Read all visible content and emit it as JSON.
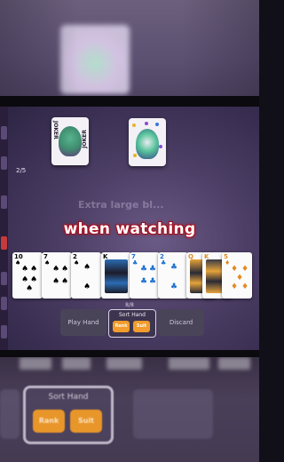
{
  "hud": {
    "hand_counter": "2/5",
    "cards_count": "8/8"
  },
  "caption": {
    "ghost_text": "Extra large bl...",
    "main_text": "when watching"
  },
  "jokers": [
    {
      "name": "joker",
      "label_left": "JOKER",
      "label_right": "JOKER"
    },
    {
      "name": "joker"
    }
  ],
  "hand": [
    {
      "rank": "10",
      "suit": "♠",
      "color": "#1b1b1b"
    },
    {
      "rank": "7",
      "suit": "♠",
      "color": "#1b1b1b"
    },
    {
      "rank": "2",
      "suit": "♠",
      "color": "#1b1b1b"
    },
    {
      "rank": "K",
      "suit": "♠",
      "color": "#1b1b1b"
    },
    {
      "rank": "7",
      "suit": "♣",
      "color": "#1c6fd1"
    },
    {
      "rank": "2",
      "suit": "♣",
      "color": "#1c6fd1"
    },
    {
      "rank": "Q",
      "suit": "♦",
      "color": "#e58a1f"
    },
    {
      "rank": "K",
      "suit": "♦",
      "color": "#e58a1f"
    },
    {
      "rank": "5",
      "suit": "♦",
      "color": "#e58a1f"
    }
  ],
  "buttons": {
    "play": "Play Hand",
    "discard": "Discard",
    "sort_title": "Sort Hand",
    "sort_rank": "Rank",
    "sort_suit": "Suit"
  },
  "bottom": {
    "sort_title": "Sort Hand",
    "sort_rank": "Rank",
    "sort_suit": "Suit"
  },
  "colors": {
    "accent_orange": "#f19c2c",
    "caption_glow": "#b3182a",
    "background": "#4d3f66"
  }
}
